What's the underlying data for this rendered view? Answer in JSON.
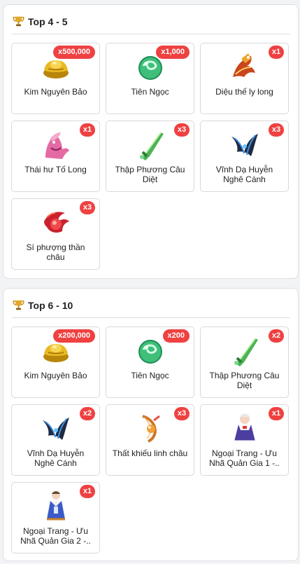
{
  "sections": [
    {
      "title": "Top 4 - 5",
      "items": [
        {
          "name": "Kim Nguyên Bảo",
          "qty": "x500,000",
          "icon": "gold-ingot-icon"
        },
        {
          "name": "Tiên Ngọc",
          "qty": "x1,000",
          "icon": "jade-orb-icon"
        },
        {
          "name": "Diệu thế ly long",
          "qty": "x1",
          "icon": "dragon-icon"
        },
        {
          "name": "Thái hư Tố Long",
          "qty": "x1",
          "icon": "pink-dragon-icon"
        },
        {
          "name": "Thập Phương Câu Diệt",
          "qty": "x3",
          "icon": "green-blade-icon"
        },
        {
          "name": "Vĩnh Dạ Huyễn Nghê Cánh",
          "qty": "x3",
          "icon": "dark-wing-icon"
        },
        {
          "name": "Sí phượng thần châu",
          "qty": "x3",
          "icon": "phoenix-pearl-icon"
        }
      ]
    },
    {
      "title": "Top 6 - 10",
      "items": [
        {
          "name": "Kim Nguyên Bảo",
          "qty": "x200,000",
          "icon": "gold-ingot-icon"
        },
        {
          "name": "Tiên Ngọc",
          "qty": "x200",
          "icon": "jade-orb-icon"
        },
        {
          "name": "Thập Phương Câu Diệt",
          "qty": "x2",
          "icon": "green-blade-icon"
        },
        {
          "name": "Vĩnh Dạ Huyễn Nghê Cánh",
          "qty": "x2",
          "icon": "dark-wing-icon"
        },
        {
          "name": "Thất khiếu linh châu",
          "qty": "x3",
          "icon": "orange-bow-icon"
        },
        {
          "name": "Ngoại Trang - Ưu Nhã Quản Gia 1 -..",
          "qty": "x1",
          "icon": "costume-purple-icon"
        },
        {
          "name": "Ngoại Trang - Ưu Nhã Quản Gia 2 -..",
          "qty": "x1",
          "icon": "costume-blue-icon"
        }
      ]
    }
  ],
  "colors": {
    "badge": "#ef4141",
    "trophy": "#d9a11e"
  }
}
